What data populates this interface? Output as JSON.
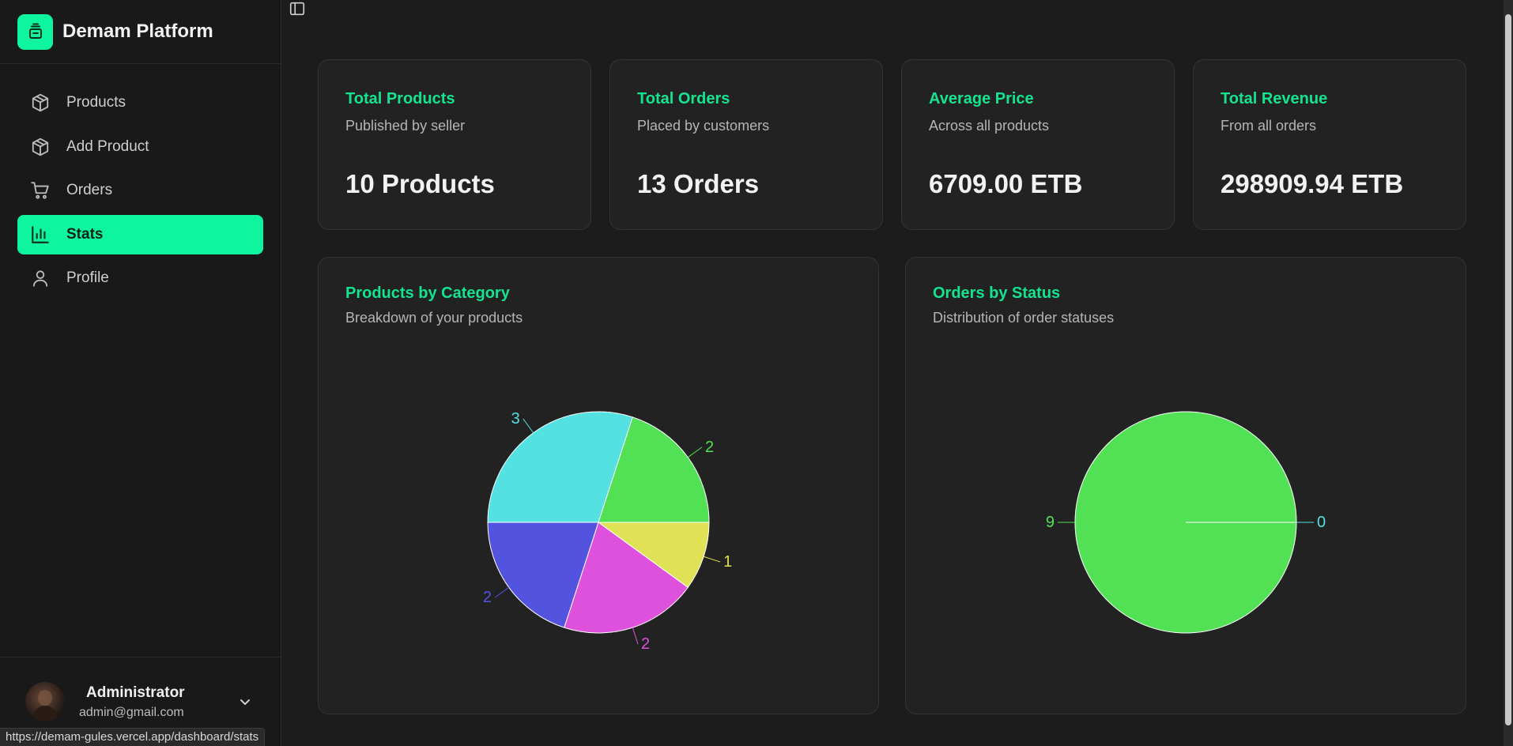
{
  "brand": {
    "name": "Demam Platform",
    "icon": "stack-icon"
  },
  "nav": [
    {
      "label": "Products",
      "icon": "package-icon",
      "active": false
    },
    {
      "label": "Add Product",
      "icon": "package-icon",
      "active": false
    },
    {
      "label": "Orders",
      "icon": "cart-icon",
      "active": false
    },
    {
      "label": "Stats",
      "icon": "bar-chart-icon",
      "active": true
    },
    {
      "label": "Profile",
      "icon": "user-icon",
      "active": false
    }
  ],
  "user": {
    "name": "Administrator",
    "email": "admin@gmail.com"
  },
  "status_url": "https://demam-gules.vercel.app/dashboard/stats",
  "stats": [
    {
      "title": "Total Products",
      "subtitle": "Published by seller",
      "value": "10 Products"
    },
    {
      "title": "Total Orders",
      "subtitle": "Placed by customers",
      "value": "13 Orders"
    },
    {
      "title": "Average Price",
      "subtitle": "Across all products",
      "value": "6709.00 ETB"
    },
    {
      "title": "Total Revenue",
      "subtitle": "From all orders",
      "value": "298909.94 ETB"
    }
  ],
  "charts": {
    "category": {
      "title": "Products by Category",
      "subtitle": "Breakdown of your products"
    },
    "status": {
      "title": "Orders by Status",
      "subtitle": "Distribution of order statuses"
    }
  },
  "colors": {
    "accent": "#0df59f",
    "title_green": "#14e38f",
    "pie_yellow": "#e0e155",
    "pie_magenta": "#dd51dd",
    "pie_blue": "#5254e0",
    "pie_cyan": "#53e1e1",
    "pie_green": "#52e055"
  },
  "chart_data": [
    {
      "type": "pie",
      "title": "Products by Category",
      "values": [
        1,
        2,
        2,
        3,
        2
      ],
      "labels": [
        "1",
        "2",
        "2",
        "3",
        "2"
      ],
      "colors": [
        "#e0e155",
        "#dd51dd",
        "#5254e0",
        "#53e1e1",
        "#52e055"
      ]
    },
    {
      "type": "pie",
      "title": "Orders by Status",
      "values": [
        9,
        0
      ],
      "labels": [
        "9",
        "0"
      ],
      "colors": [
        "#52e055",
        "#53e1e1"
      ]
    }
  ]
}
